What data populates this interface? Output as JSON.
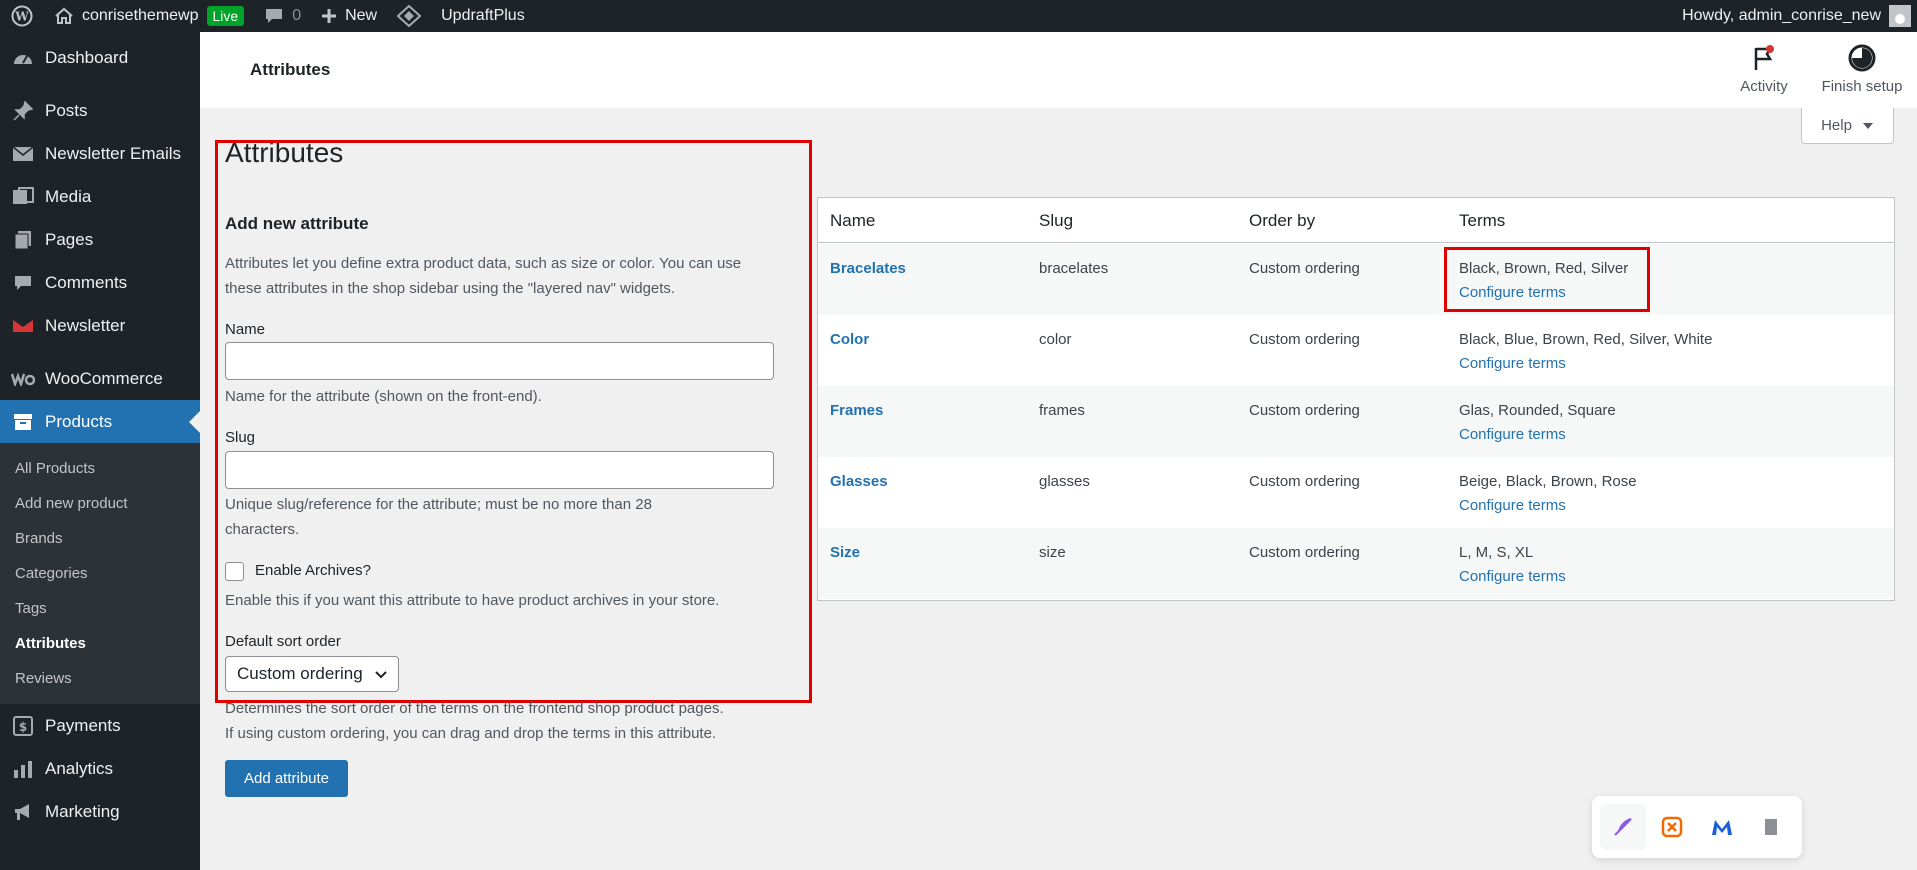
{
  "adminbar": {
    "site_name": "conrisethemewp",
    "live_badge": "Live",
    "comments_count": "0",
    "new_label": "New",
    "plugin_label": "UpdraftPlus",
    "howdy": "Howdy, admin_conrise_new"
  },
  "sidebar": {
    "items": [
      {
        "label": "Dashboard",
        "icon": "dashboard-icon"
      },
      {
        "label": "Posts",
        "icon": "pin-icon"
      },
      {
        "label": "Newsletter Emails",
        "icon": "email-icon"
      },
      {
        "label": "Media",
        "icon": "media-icon"
      },
      {
        "label": "Pages",
        "icon": "pages-icon"
      },
      {
        "label": "Comments",
        "icon": "comment-icon"
      },
      {
        "label": "Newsletter",
        "icon": "newsletter-icon"
      },
      {
        "label": "WooCommerce",
        "icon": "woo-icon"
      },
      {
        "label": "Products",
        "icon": "archive-icon"
      },
      {
        "label": "Payments",
        "icon": "dollar-icon"
      },
      {
        "label": "Analytics",
        "icon": "chart-icon"
      },
      {
        "label": "Marketing",
        "icon": "megaphone-icon"
      }
    ],
    "products_submenu": [
      "All Products",
      "Add new product",
      "Brands",
      "Categories",
      "Tags",
      "Attributes",
      "Reviews"
    ]
  },
  "header": {
    "title": "Attributes",
    "activity_label": "Activity",
    "finish_setup_label": "Finish setup",
    "help_label": "Help"
  },
  "form": {
    "page_title": "Attributes",
    "heading": "Add new attribute",
    "intro_line1": "Attributes let you define extra product data, such as size or color. You can use",
    "intro_line2": "these attributes in the shop sidebar using the \"layered nav\" widgets.",
    "name_label": "Name",
    "name_value": "",
    "name_help": "Name for the attribute (shown on the front-end).",
    "slug_label": "Slug",
    "slug_value": "",
    "slug_help_line1": "Unique slug/reference for the attribute; must be no more than 28",
    "slug_help_line2": "characters.",
    "archives_label": "Enable Archives?",
    "archives_help": "Enable this if you want this attribute to have product archives in your store.",
    "sort_label": "Default sort order",
    "sort_value": "Custom ordering",
    "sort_help_line1": "Determines the sort order of the terms on the frontend shop product pages.",
    "sort_help_line2": "If using custom ordering, you can drag and drop the terms in this attribute.",
    "submit_label": "Add attribute"
  },
  "table": {
    "columns": [
      "Name",
      "Slug",
      "Order by",
      "Terms"
    ],
    "configure_label": "Configure terms",
    "rows": [
      {
        "name": "Bracelates",
        "slug": "bracelates",
        "order": "Custom ordering",
        "terms": "Black, Brown, Red, Silver"
      },
      {
        "name": "Color",
        "slug": "color",
        "order": "Custom ordering",
        "terms": "Black, Blue, Brown, Red, Silver, White"
      },
      {
        "name": "Frames",
        "slug": "frames",
        "order": "Custom ordering",
        "terms": "Glas, Rounded, Square"
      },
      {
        "name": "Glasses",
        "slug": "glasses",
        "order": "Custom ordering",
        "terms": "Beige, Black, Brown, Rose"
      },
      {
        "name": "Size",
        "slug": "size",
        "order": "Custom ordering",
        "terms": "L, M, S, XL"
      }
    ]
  },
  "colors": {
    "admin_dark": "#1d2327",
    "accent_blue": "#2271b1",
    "highlight_red": "#e00000",
    "live_green": "#00a32a"
  }
}
